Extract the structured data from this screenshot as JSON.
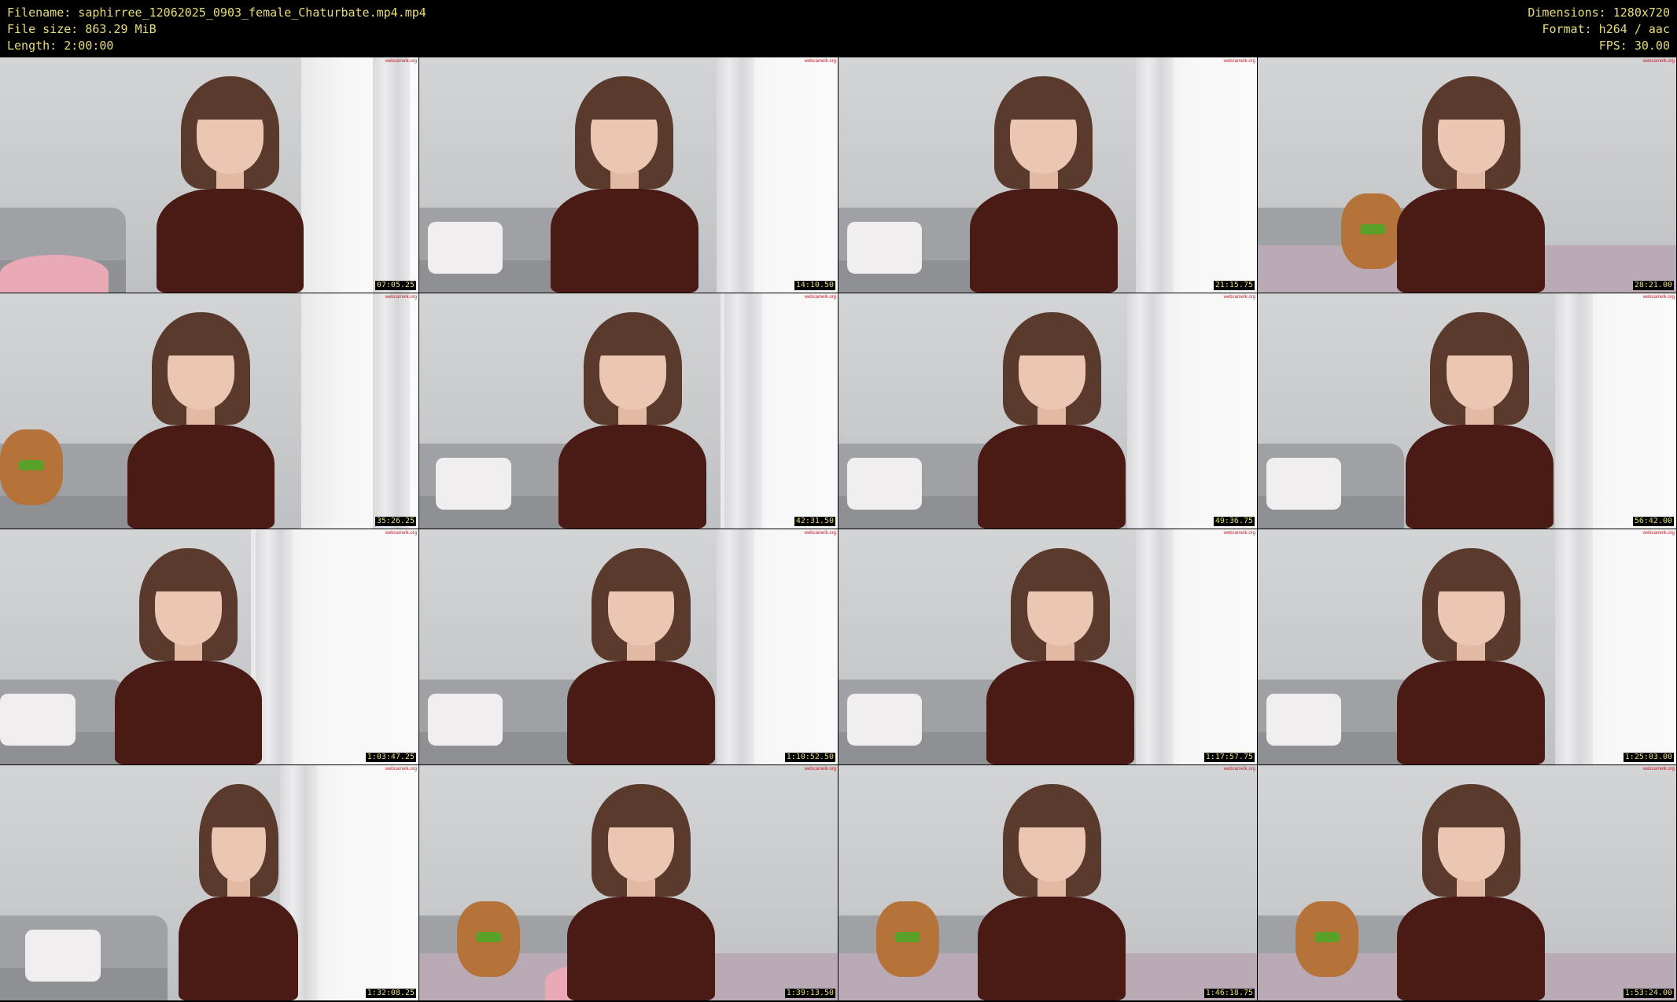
{
  "header": {
    "filename_label": "Filename: saphirree_12062025_0903_female_Chaturbate.mp4.mp4",
    "filesize_label": "File size: 863.29 MiB",
    "length_label": "Length: 2:00:00",
    "dimensions_label": "Dimensions: 1280x720",
    "format_label": "Format: h264 / aac",
    "fps_label": "FPS: 30.00"
  },
  "colors": {
    "background": "#000000",
    "meta_text": "#e8dc7a",
    "watermark": "#c4202a"
  },
  "thumbnails": [
    {
      "timestamp": "07:05.25",
      "watermark": "webcamelk.org"
    },
    {
      "timestamp": "14:10.50",
      "watermark": "webcamelk.org"
    },
    {
      "timestamp": "21:15.75",
      "watermark": "webcamelk.org"
    },
    {
      "timestamp": "28:21.00",
      "watermark": "webcamelk.org"
    },
    {
      "timestamp": "35:26.25",
      "watermark": "webcamelk.org"
    },
    {
      "timestamp": "42:31.50",
      "watermark": "webcamelk.org"
    },
    {
      "timestamp": "49:36.75",
      "watermark": "webcamelk.org"
    },
    {
      "timestamp": "56:42.00",
      "watermark": "webcamelk.org"
    },
    {
      "timestamp": "1:03:47.25",
      "watermark": "webcamelk.org"
    },
    {
      "timestamp": "1:10:52.50",
      "watermark": "webcamelk.org"
    },
    {
      "timestamp": "1:17:57.75",
      "watermark": "webcamelk.org"
    },
    {
      "timestamp": "1:25:03.00",
      "watermark": "webcamelk.org"
    },
    {
      "timestamp": "1:32:08.25",
      "watermark": "webcamelk.org"
    },
    {
      "timestamp": "1:39:13.50",
      "watermark": "webcamelk.org"
    },
    {
      "timestamp": "1:46:18.75",
      "watermark": "webcamelk.org"
    },
    {
      "timestamp": "1:53:24.00",
      "watermark": "webcamelk.org"
    }
  ]
}
